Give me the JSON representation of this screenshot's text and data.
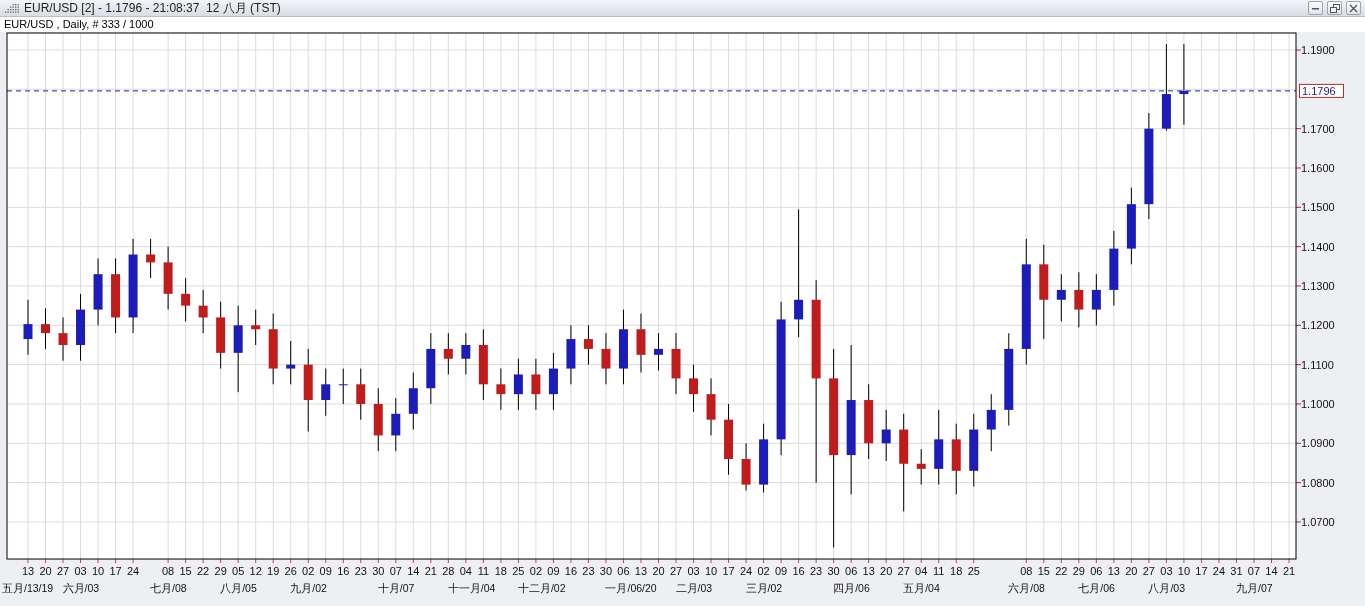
{
  "window": {
    "title": "EUR/USD [2] - 1.1796 - 21:08:37  12 八月 (TST)"
  },
  "chart": {
    "header": "EUR/USD , Daily, # 333 / 1000",
    "current_price_label": "1.1796",
    "y_axis_labels": [
      "1.1900",
      "1.1700",
      "1.1600",
      "1.1500",
      "1.1400",
      "1.1300",
      "1.1200",
      "1.1100",
      "1.1000",
      "1.0900",
      "1.0800",
      "1.0700"
    ],
    "x_axis_labels": [
      "13",
      "20",
      "27",
      "03",
      "10",
      "17",
      "24",
      "08",
      "15",
      "22",
      "29",
      "05",
      "12",
      "19",
      "26",
      "02",
      "09",
      "16",
      "23",
      "30",
      "07",
      "14",
      "21",
      "28",
      "04",
      "11",
      "18",
      "25",
      "02",
      "09",
      "16",
      "23",
      "30",
      "06",
      "13",
      "20",
      "27",
      "03",
      "10",
      "17",
      "24",
      "02",
      "09",
      "16",
      "23",
      "30",
      "06",
      "13",
      "20",
      "27",
      "04",
      "11",
      "18",
      "25",
      "08",
      "15",
      "22",
      "29",
      "06",
      "13",
      "20",
      "27",
      "03",
      "10",
      "17",
      "24",
      "31",
      "07",
      "14",
      "21"
    ],
    "month_labels": [
      "五月/13/19",
      "六月/03",
      "七月/08",
      "八月/05",
      "九月/02",
      "十月/07",
      "十一月/04",
      "十二月/02",
      "一月/06/20",
      "二月/03",
      "三月/02",
      "四月/06",
      "五月/04",
      "六月/08",
      "七月/06",
      "八月/03",
      "九月/07"
    ]
  }
}
